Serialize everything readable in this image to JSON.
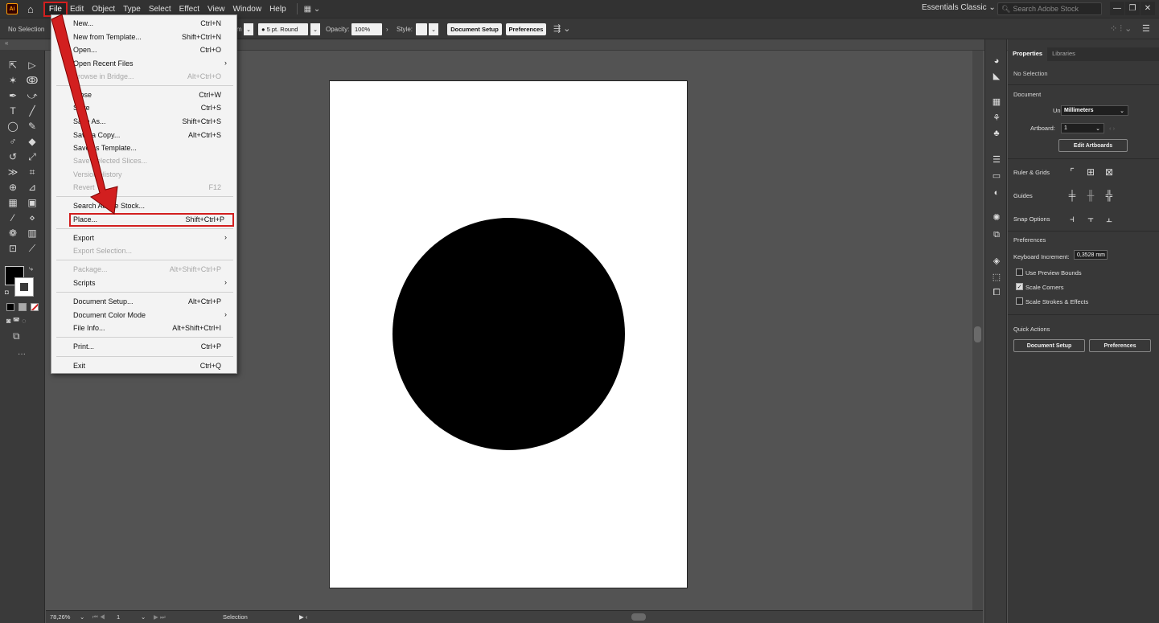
{
  "app": {
    "logo_text": "Ai"
  },
  "menubar": {
    "items": [
      "File",
      "Edit",
      "Object",
      "Type",
      "Select",
      "Effect",
      "View",
      "Window",
      "Help"
    ],
    "active_item": "File",
    "workspace": "Essentials Classic",
    "search_placeholder": "Search Adobe Stock"
  },
  "controlbar": {
    "selection_label": "No Selection",
    "stroke_unit_suffix": "m",
    "brush": "5 pt. Round",
    "opacity_label": "Opacity:",
    "opacity_value": "100%",
    "style_label": "Style:",
    "document_setup": "Document Setup",
    "preferences": "Preferences"
  },
  "file_menu": {
    "items": [
      {
        "label": "New...",
        "shortcut": "Ctrl+N",
        "disabled": false
      },
      {
        "label": "New from Template...",
        "shortcut": "Shift+Ctrl+N",
        "disabled": false
      },
      {
        "label": "Open...",
        "shortcut": "Ctrl+O",
        "disabled": false
      },
      {
        "label": "Open Recent Files",
        "shortcut": "",
        "submenu": true,
        "disabled": false
      },
      {
        "label": "Browse in Bridge...",
        "shortcut": "Alt+Ctrl+O",
        "disabled": true
      },
      {
        "label": "Close",
        "shortcut": "Ctrl+W",
        "disabled": false
      },
      {
        "label": "Save",
        "shortcut": "Ctrl+S",
        "disabled": false
      },
      {
        "label": "Save As...",
        "shortcut": "Shift+Ctrl+S",
        "disabled": false
      },
      {
        "label": "Save a Copy...",
        "shortcut": "Alt+Ctrl+S",
        "disabled": false
      },
      {
        "label": "Save as Template...",
        "shortcut": "",
        "disabled": false
      },
      {
        "label": "Save Selected Slices...",
        "shortcut": "",
        "disabled": true
      },
      {
        "label": "Version History",
        "shortcut": "",
        "disabled": true
      },
      {
        "label": "Revert",
        "shortcut": "F12",
        "disabled": true
      },
      {
        "label": "Search Adobe Stock...",
        "shortcut": "",
        "disabled": false
      },
      {
        "label": "Place...",
        "shortcut": "Shift+Ctrl+P",
        "disabled": false,
        "highlighted": true
      },
      {
        "label": "Export",
        "shortcut": "",
        "submenu": true,
        "disabled": false
      },
      {
        "label": "Export Selection...",
        "shortcut": "",
        "disabled": true
      },
      {
        "label": "Package...",
        "shortcut": "Alt+Shift+Ctrl+P",
        "disabled": true
      },
      {
        "label": "Scripts",
        "shortcut": "",
        "submenu": true,
        "disabled": false
      },
      {
        "label": "Document Setup...",
        "shortcut": "Alt+Ctrl+P",
        "disabled": false
      },
      {
        "label": "Document Color Mode",
        "shortcut": "",
        "submenu": true,
        "disabled": false
      },
      {
        "label": "File Info...",
        "shortcut": "Alt+Shift+Ctrl+I",
        "disabled": false
      },
      {
        "label": "Print...",
        "shortcut": "Ctrl+P",
        "disabled": false
      },
      {
        "label": "Exit",
        "shortcut": "Ctrl+Q",
        "disabled": false
      }
    ]
  },
  "statusbar": {
    "zoom": "78,26%",
    "artboard_number": "1",
    "tool": "Selection"
  },
  "properties": {
    "tab_properties": "Properties",
    "tab_libraries": "Libraries",
    "selection": "No Selection",
    "document_header": "Document",
    "units_label": "Units:",
    "units_value": "Millimeters",
    "artboard_label": "Artboard:",
    "artboard_value": "1",
    "edit_artboards": "Edit Artboards",
    "rulers_grids": "Ruler & Grids",
    "guides": "Guides",
    "snap_options": "Snap Options",
    "preferences_header": "Preferences",
    "keyboard_increment_label": "Keyboard Increment:",
    "keyboard_increment_value": "0,3528 mm",
    "use_preview_bounds": "Use Preview Bounds",
    "scale_corners": "Scale Corners",
    "scale_strokes": "Scale Strokes & Effects",
    "quick_actions": "Quick Actions",
    "qa_document_setup": "Document Setup",
    "qa_preferences": "Preferences",
    "use_preview_bounds_checked": false,
    "scale_corners_checked": true,
    "scale_strokes_checked": false
  },
  "colors": {
    "annotation_red": "#d21f1f",
    "fill": "#000000",
    "stroke": "#ffffff"
  }
}
